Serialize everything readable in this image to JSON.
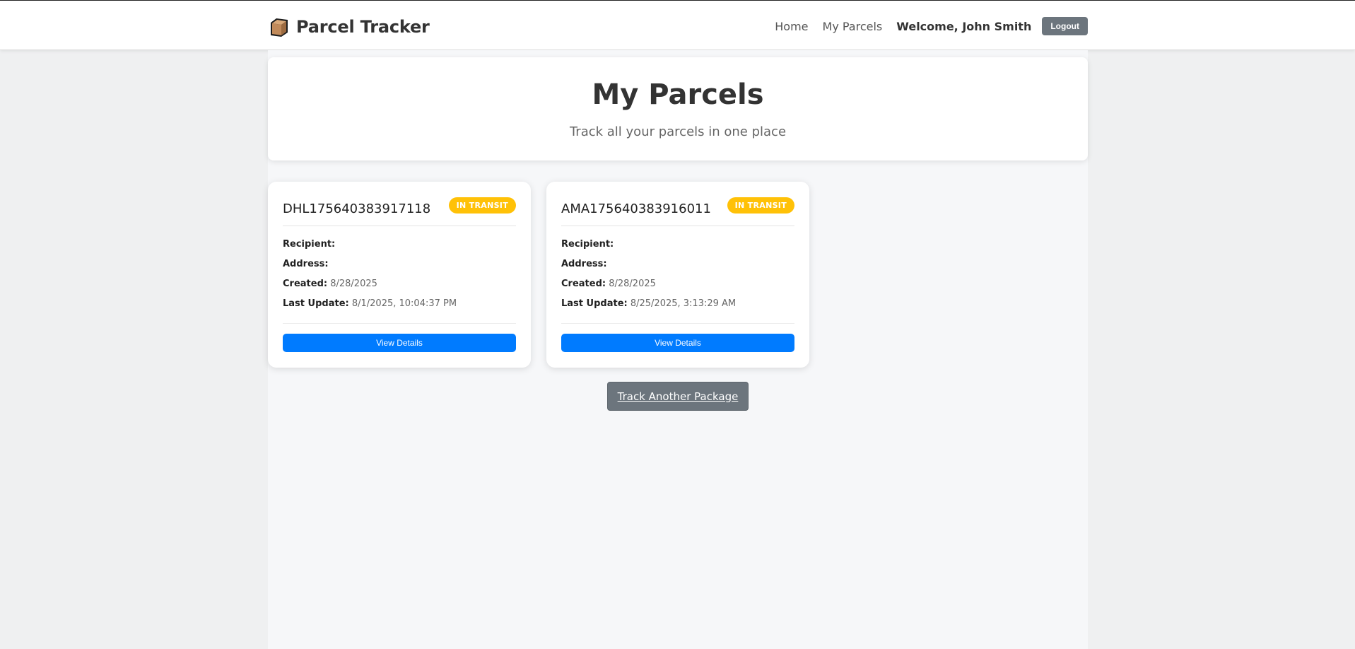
{
  "navbar": {
    "brand": "Parcel Tracker",
    "brand_icon": "package-box-icon",
    "links": {
      "home": "Home",
      "my_parcels": "My Parcels"
    },
    "welcome": "Welcome, John Smith",
    "logout": "Logout"
  },
  "hero": {
    "title": "My Parcels",
    "subtitle": "Track all your parcels in one place"
  },
  "parcels": [
    {
      "tracking_id": "DHL175640383917118",
      "status": "IN TRANSIT",
      "recipient_label": "Recipient:",
      "recipient": "",
      "address_label": "Address:",
      "address": "",
      "created_label": "Created:",
      "created": "8/28/2025",
      "last_update_label": "Last Update:",
      "last_update": "8/1/2025, 10:04:37 PM",
      "button": "View Details"
    },
    {
      "tracking_id": "AMA175640383916011",
      "status": "IN TRANSIT",
      "recipient_label": "Recipient:",
      "recipient": "",
      "address_label": "Address:",
      "address": "",
      "created_label": "Created:",
      "created": "8/28/2025",
      "last_update_label": "Last Update:",
      "last_update": "8/25/2025, 3:13:29 AM",
      "button": "View Details"
    }
  ],
  "actions": {
    "track_another": "Track Another Package"
  },
  "colors": {
    "primary": "#007bff",
    "secondary": "#6c757d",
    "status_in_transit": "#ffc107"
  }
}
